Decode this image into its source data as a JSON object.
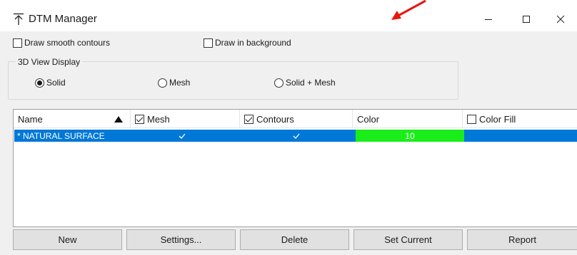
{
  "window": {
    "title": "DTM Manager",
    "icon": "dtm-app-icon"
  },
  "options": {
    "draw_smooth_contours": {
      "label": "Draw smooth contours",
      "checked": false
    },
    "draw_in_background": {
      "label": "Draw in background",
      "checked": false
    }
  },
  "view_display": {
    "label": "3D View Display",
    "options": [
      {
        "label": "Solid",
        "selected": true
      },
      {
        "label": "Mesh",
        "selected": false
      },
      {
        "label": "Solid + Mesh",
        "selected": false
      }
    ]
  },
  "table": {
    "columns": [
      {
        "label": "Name",
        "sort": "ascending"
      },
      {
        "label": "Mesh",
        "checked": true
      },
      {
        "label": "Contours",
        "checked": true
      },
      {
        "label": "Color"
      },
      {
        "label": "Color Fill",
        "checked": false
      }
    ],
    "rows": [
      {
        "name": "* NATURAL SURFACE",
        "mesh": true,
        "contours": true,
        "color_value": "10",
        "color_hex": "#1aee1a",
        "selected": true
      }
    ]
  },
  "buttons": {
    "new": "New",
    "settings": "Settings...",
    "delete": "Delete",
    "set_current": "Set Current",
    "report": "Report"
  },
  "colors": {
    "selection": "#0078d7",
    "annotation_arrow": "#e8160c"
  }
}
